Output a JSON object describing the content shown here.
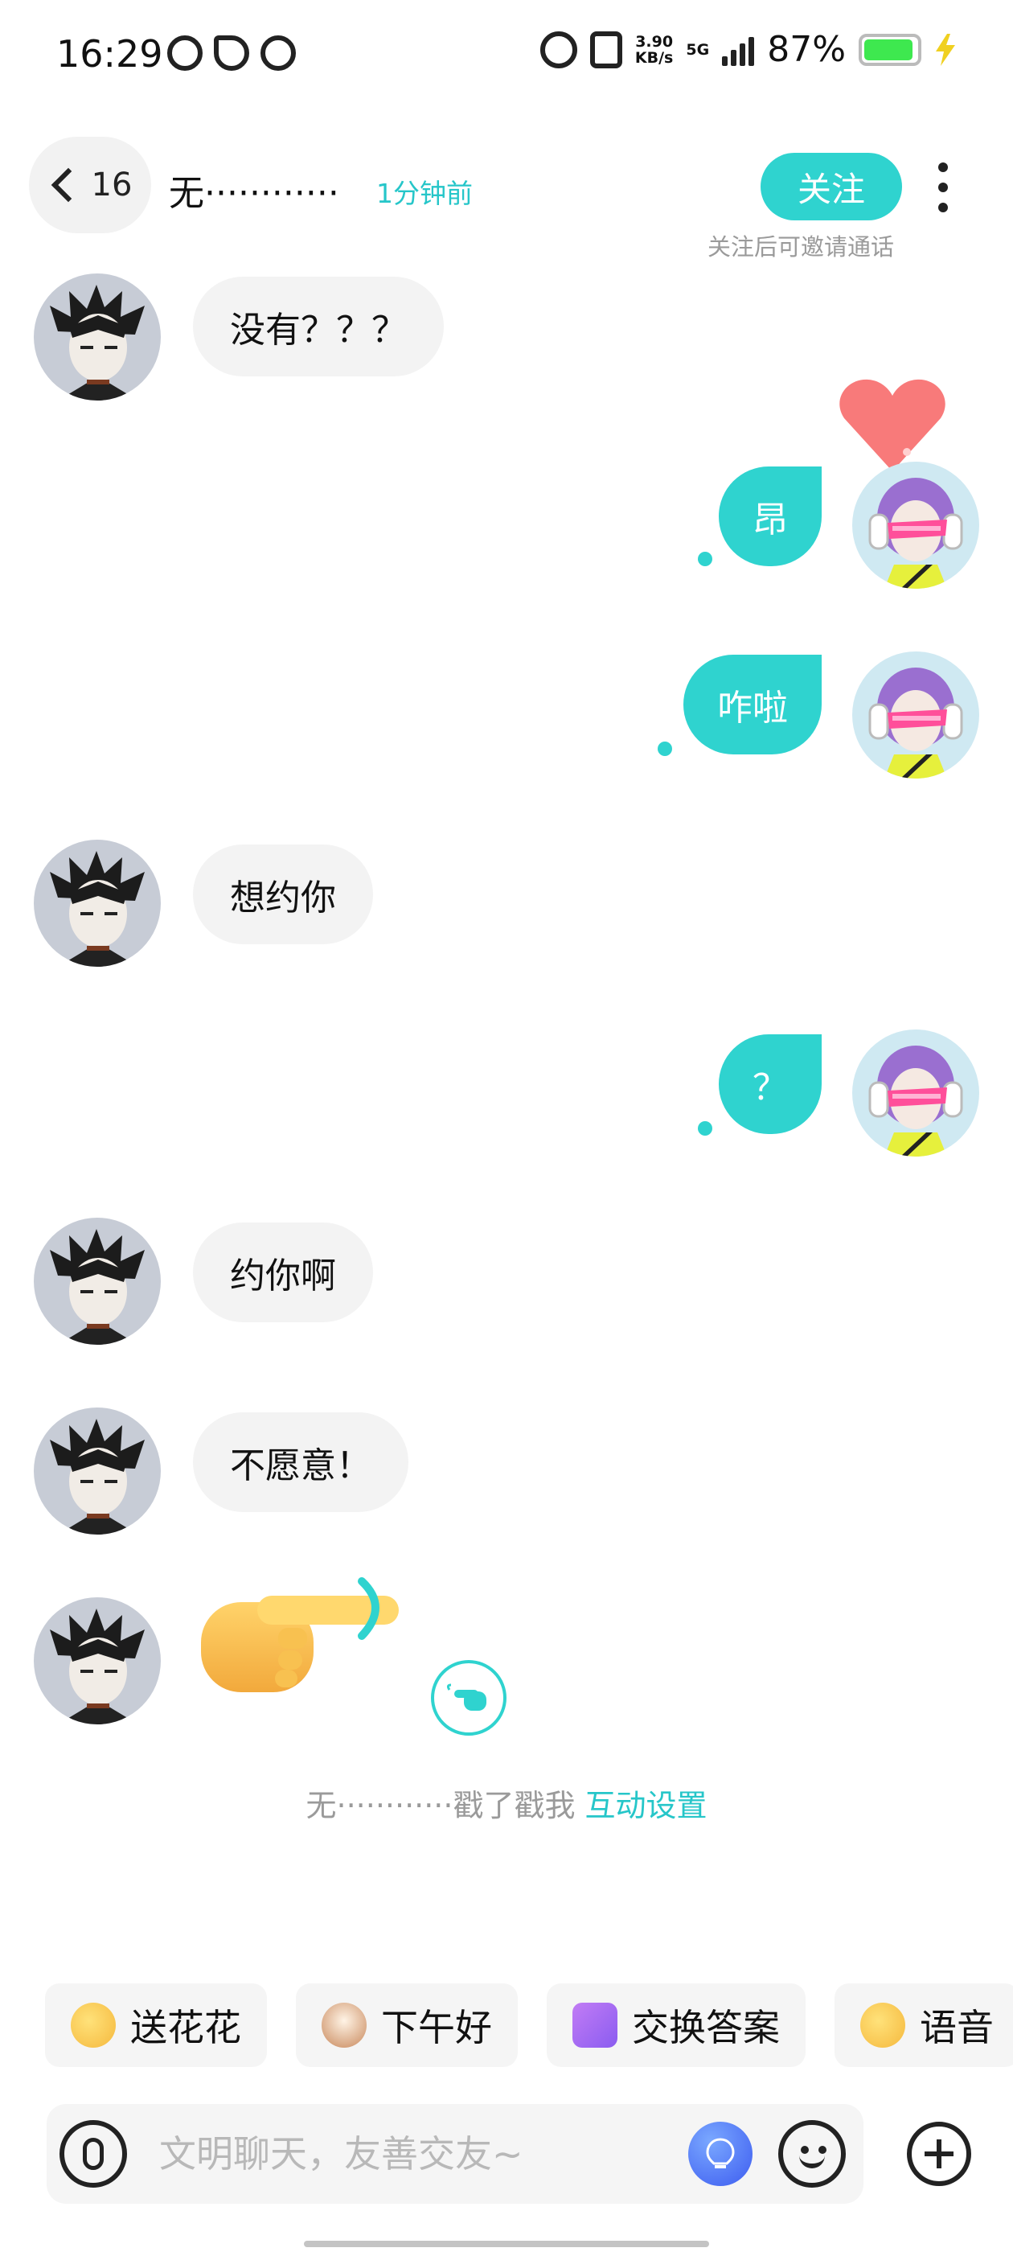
{
  "status_bar": {
    "time": "16:29",
    "net_speed_value": "3.90",
    "net_speed_unit": "KB/s",
    "network": "5G",
    "battery": "87%",
    "app_icons": [
      "weibo-notification-icon",
      "tiktok-icon",
      "weibo-icon"
    ],
    "right_icons": [
      "alarm-icon",
      "vibrate-icon",
      "signal-icon",
      "battery-icon",
      "charging-bolt-icon"
    ]
  },
  "header": {
    "back_count": "16",
    "peer_name": "无············",
    "last_seen": "1分钟前",
    "follow_label": "关注",
    "follow_hint": "关注后可邀请通话"
  },
  "messages": [
    {
      "side": "in",
      "text": "没有？？？"
    },
    {
      "side": "out",
      "text": "昂"
    },
    {
      "side": "out",
      "text": "咋啦"
    },
    {
      "side": "in",
      "text": "想约你"
    },
    {
      "side": "out",
      "text": "？"
    },
    {
      "side": "in",
      "text": "约你啊"
    },
    {
      "side": "in",
      "text": "不愿意！"
    },
    {
      "side": "in",
      "type": "poke",
      "icon": "pointing-hand-icon"
    }
  ],
  "system": {
    "poke_text": "无············戳了戳我",
    "interaction_link": "互动设置"
  },
  "quick_replies": [
    {
      "label": "送花花",
      "icon": "flower-emoji-icon",
      "color": "#f7c948"
    },
    {
      "label": "下午好",
      "icon": "coffee-icon",
      "color": "#c8875a"
    },
    {
      "label": "交换答案",
      "icon": "exchange-icon",
      "color": "#a06cf0"
    },
    {
      "label": "语音",
      "icon": "voice-emoji-icon",
      "color": "#f5b83d"
    }
  ],
  "input": {
    "placeholder": "文明聊天，友善交友~"
  },
  "colors": {
    "accent": "#2fd3cf",
    "accent_text": "#26c6c9",
    "incoming_bubble": "#f3f3f3",
    "muted_text": "#9a9a9a"
  }
}
